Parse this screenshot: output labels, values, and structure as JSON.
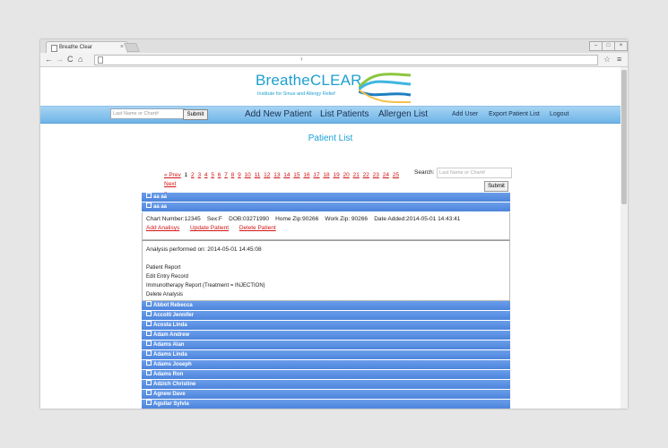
{
  "browser": {
    "tab_title": "Breathe Clear",
    "tab_close": "×",
    "win_min": "–",
    "win_max": "□",
    "win_close": "×",
    "back": "←",
    "forward": "→",
    "reload": "C",
    "home": "⌂",
    "omnibox_chevron": "›",
    "star": "☆",
    "menu": "≡"
  },
  "logo": {
    "title": "BreatheCLEAR",
    "tagline": "Institute for Sinus and Allergy Relief"
  },
  "nav": {
    "search_placeholder": "Last Name or Chart#",
    "submit": "Submit",
    "add_patient": "Add New Patient",
    "list_patients": "List Patients",
    "allergen_list": "Allergen List",
    "add_user": "Add User",
    "export": "Export Patient List",
    "logout": "Logout"
  },
  "page_title": "Patient List",
  "pager": {
    "prev": "« Prev",
    "current": "1",
    "pages": [
      "2",
      "3",
      "4",
      "5",
      "6",
      "7",
      "8",
      "9",
      "10",
      "11",
      "12",
      "13",
      "14",
      "15",
      "16",
      "17",
      "18",
      "19",
      "20",
      "21",
      "22",
      "23",
      "24",
      "25"
    ],
    "next": "Next",
    "last": "»"
  },
  "search": {
    "label": "Search:",
    "placeholder": "Last Name or Chart#",
    "submit": "Submit"
  },
  "patients_top": [
    "aa aa",
    "aa aa"
  ],
  "detail": {
    "info": "Chart Number:12345    Sex:F    DOB:03271990    Home Zip:90266    Work Zip: 90266    Date Added:2014-05-01 14:43:41",
    "add_analysis": "Add Analisys",
    "update_patient": "Update Patient",
    "delete_patient": "Delete Patient"
  },
  "analysis": {
    "date": "Analysis performed on: 2014-05-01 14:45:08",
    "patient_report": "Patient Report",
    "edit_entry": "Edit Entry Record",
    "immuno_report": "Immunotherapy Report (Treatment = INJECTION)",
    "delete_analysis": "Delete Analysis"
  },
  "patients": [
    "Abbot Rebecca",
    "Accolti Jennifer",
    "Acosta Linda",
    "Adam Andrew",
    "Adams Alan",
    "Adams Linda",
    "Adams Joseph",
    "Adams Ron",
    "Adzich Christine",
    "Agnew Dave",
    "Aguilar Sylvia"
  ],
  "colors": {
    "accent": "#1aa0d9",
    "row": "#5a8ee2",
    "link": "#d21515"
  }
}
